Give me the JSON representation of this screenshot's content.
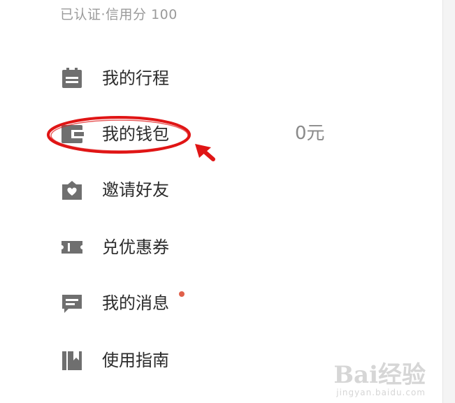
{
  "status": {
    "text": "已认证·信用分  100"
  },
  "menu": {
    "items": [
      {
        "label": "我的行程",
        "icon": "itinerary-icon"
      },
      {
        "label": "我的钱包",
        "icon": "wallet-icon",
        "value": "0元"
      },
      {
        "label": "邀请好友",
        "icon": "invite-icon"
      },
      {
        "label": "兑优惠券",
        "icon": "coupon-icon"
      },
      {
        "label": "我的消息",
        "icon": "message-icon",
        "has_unread": true
      },
      {
        "label": "使用指南",
        "icon": "guide-icon"
      }
    ]
  },
  "annotation": {
    "color": "#e01515"
  },
  "watermark": {
    "logo": "Bai经验",
    "url": "jingyan.baidu.com"
  },
  "colors": {
    "icon": "#6f6f6f",
    "unread_dot": "#e0604a"
  }
}
